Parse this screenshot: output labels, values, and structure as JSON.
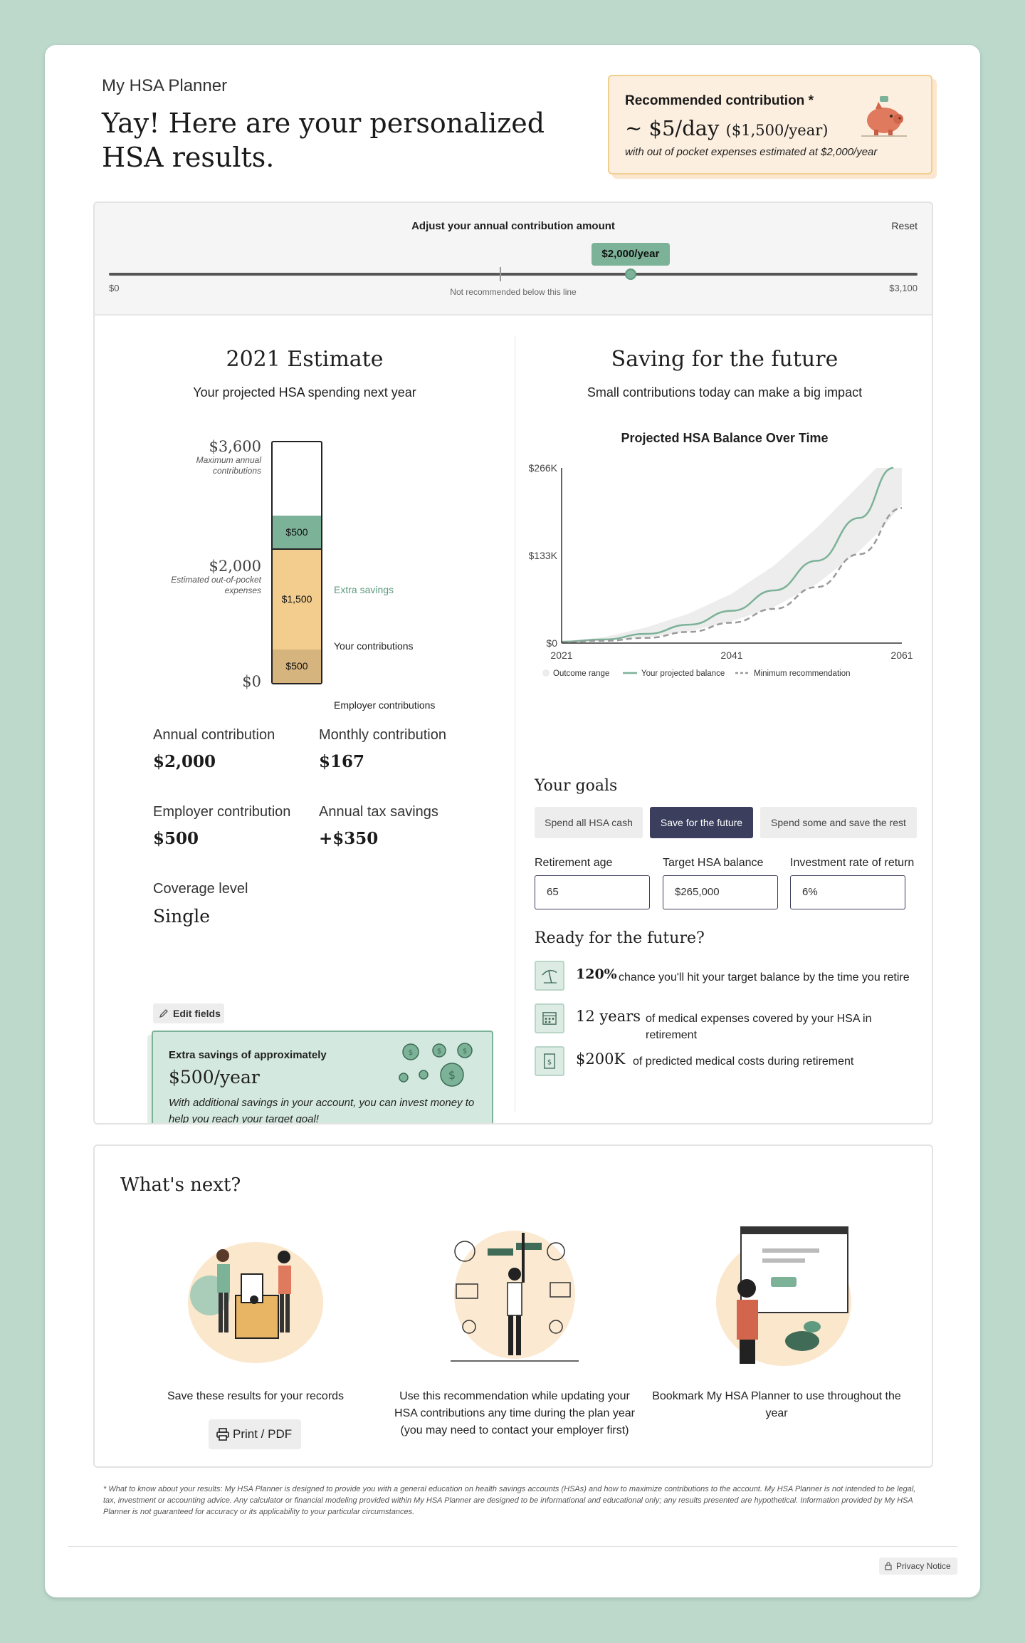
{
  "header": {
    "app_title": "My HSA Planner",
    "page_title": "Yay! Here are your personalized HSA results."
  },
  "recommendation": {
    "title": "Recommended contribution *",
    "per_day": "~ $5/day",
    "per_year": "($1,500/year)",
    "note": "with out of pocket expenses estimated at $2,000/year",
    "icon": "piggy-bank-icon"
  },
  "slider": {
    "title": "Adjust your annual contribution amount",
    "reset_label": "Reset",
    "value_label": "$2,000/year",
    "value": 2000,
    "min_label": "$0",
    "max_label": "$3,100",
    "min": 0,
    "max": 3100,
    "threshold_note": "Not recommended below this line",
    "threshold": 1500,
    "accent": "#7cb298"
  },
  "estimate": {
    "title": "2021 Estimate",
    "subtitle": "Your projected HSA spending next year",
    "y_labels": [
      {
        "value": "$3,600",
        "desc": "Maximum annual contributions"
      },
      {
        "value": "$2,000",
        "desc": "Estimated out-of-pocket expenses"
      },
      {
        "value": "$0",
        "desc": ""
      }
    ],
    "segments": [
      {
        "label": "$500",
        "legend": "Extra savings",
        "amount": 500,
        "color": "#7cb298"
      },
      {
        "label": "$1,500",
        "legend": "Your contributions",
        "amount": 1500,
        "color": "#f3cd8e"
      },
      {
        "label": "$500",
        "legend": "Employer contributions",
        "amount": 500,
        "color": "#d6b47d"
      }
    ],
    "max": 3600,
    "stats": {
      "annual_label": "Annual contribution",
      "annual_value": "$2,000",
      "monthly_label": "Monthly contribution",
      "monthly_value": "$167",
      "employer_label": "Employer contribution",
      "employer_value": "$500",
      "tax_label": "Annual tax savings",
      "tax_value": "+$350",
      "coverage_label": "Coverage level",
      "coverage_value": "Single"
    },
    "edit_label": "Edit fields"
  },
  "extra_savings": {
    "title": "Extra savings of approximately",
    "amount": "$500/year",
    "note": "With additional savings in your account, you can invest money to help you reach your target goal!",
    "icon": "coins-icon"
  },
  "future": {
    "title": "Saving for the future",
    "subtitle": "Small contributions today can make a big impact"
  },
  "chart_data": {
    "type": "area",
    "title": "Projected HSA Balance Over Time",
    "x_ticks": [
      "2021",
      "2041",
      "2061"
    ],
    "y_ticks": [
      "$0",
      "$133K",
      "$266K"
    ],
    "xlim": [
      2021,
      2061
    ],
    "ylim": [
      0,
      266000
    ],
    "grid": false,
    "legend_position": "bottom",
    "series": [
      {
        "name": "Your projected balance",
        "style": "solid",
        "color": "#7cb298",
        "x": [
          2021,
          2026,
          2031,
          2036,
          2041,
          2046,
          2051,
          2056,
          2060
        ],
        "y": [
          2000,
          5500,
          14000,
          28000,
          49000,
          80000,
          125000,
          190000,
          266000
        ]
      },
      {
        "name": "Minimum recommendation",
        "style": "dashed",
        "color": "#9a9a9a",
        "x": [
          2021,
          2026,
          2031,
          2036,
          2041,
          2046,
          2051,
          2056,
          2061
        ],
        "y": [
          1500,
          3500,
          8000,
          17000,
          31000,
          52000,
          85000,
          135000,
          205000
        ]
      },
      {
        "name": "Outcome range",
        "style": "band",
        "color": "#ededed",
        "x": [
          2021,
          2026,
          2031,
          2036,
          2041,
          2046,
          2051,
          2056,
          2058,
          2061
        ],
        "upper": [
          2500,
          9000,
          24000,
          45000,
          75000,
          118000,
          175000,
          240000,
          266000,
          266000
        ],
        "lower": [
          1500,
          3500,
          8500,
          18000,
          33000,
          55000,
          90000,
          140000,
          165000,
          210000
        ]
      }
    ]
  },
  "goals": {
    "title": "Your goals",
    "options": [
      "Spend all HSA cash",
      "Save for the future",
      "Spend some and save the rest"
    ],
    "active_index": 1,
    "fields": [
      {
        "label": "Retirement age",
        "value": "65"
      },
      {
        "label": "Target HSA balance",
        "value": "$265,000"
      },
      {
        "label": "Investment rate of return",
        "value": "6%"
      }
    ]
  },
  "ready": {
    "title": "Ready for the future?",
    "items": [
      {
        "big": "120%",
        "text": "chance you'll hit your target balance by the time you retire",
        "icon": "beach-umbrella-icon"
      },
      {
        "big": "12 years",
        "text": "of medical expenses covered by your HSA in retirement",
        "icon": "calendar-icon"
      },
      {
        "big": "$200K",
        "text": "of predicted medical costs during retirement",
        "icon": "dollar-document-icon"
      }
    ]
  },
  "next": {
    "title": "What's next?",
    "items": [
      {
        "text": "Save these results for your records",
        "illustration": "people-filing-illustration"
      },
      {
        "text": "Use this recommendation while updating your HSA contributions any time during the plan year (you may need to contact your employer first)",
        "illustration": "decision-signpost-illustration"
      },
      {
        "text": "Bookmark My HSA Planner to use throughout the year",
        "illustration": "woman-browser-illustration"
      }
    ],
    "print_label": "Print / PDF"
  },
  "disclaimer": "* What to know about your results: My HSA Planner is designed to provide you with a general education on health savings accounts (HSAs) and how to maximize contributions to the account. My HSA Planner is not intended to be legal, tax, investment or accounting advice. Any calculator or financial modeling provided within My HSA Planner are designed to be informational and educational only; any results presented are hypothetical.  Information provided by My HSA Planner is not guaranteed for accuracy or its applicability to your particular circumstances.",
  "footer": {
    "privacy_label": "Privacy Notice"
  }
}
